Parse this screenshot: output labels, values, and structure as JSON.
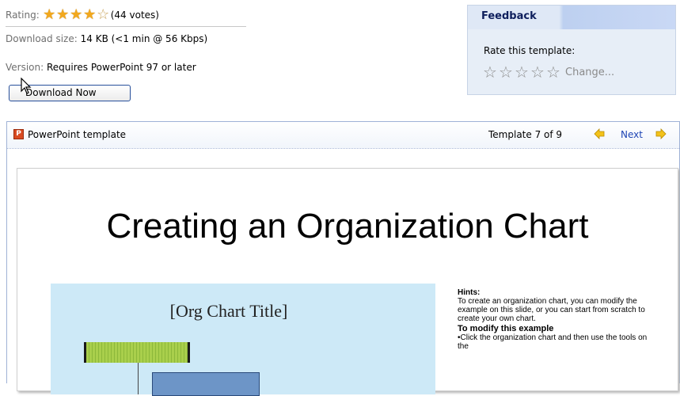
{
  "info": {
    "rating_label": "Rating:",
    "rating_votes": "(44 votes)",
    "rating_stars_filled": 4,
    "rating_stars_total": 5,
    "size_label": "Download size:",
    "size_value": "14 KB (<1 min @ 56 Kbps)",
    "version_label": "Version:",
    "version_value": "Requires PowerPoint 97 or later",
    "download_button": "Download Now"
  },
  "feedback": {
    "title": "Feedback",
    "rate_label": "Rate this template:",
    "change_link": "Change..."
  },
  "template": {
    "name": "PowerPoint template",
    "count": "Template 7 of 9",
    "next": "Next"
  },
  "slide": {
    "title": "Creating an Organization Chart",
    "chart_title": "[Org Chart Title]",
    "hints_heading": "Hints:",
    "hints_text": "To create an organization chart, you can modify the example on this slide, or you can start from scratch to create your own chart.",
    "modify_heading": "To modify this example",
    "modify_text": "•Click the organization chart and then use the tools on the"
  },
  "icons": {
    "star_full": "★",
    "star_empty": "☆",
    "ppt_icon": "P",
    "arrow_left": "◆",
    "arrow_right": "◆"
  },
  "colors": {
    "star": "#f2a81d",
    "link": "#1e45b4",
    "feedback_bg": "#e7eef7",
    "chart_bg": "#cde9f7"
  }
}
